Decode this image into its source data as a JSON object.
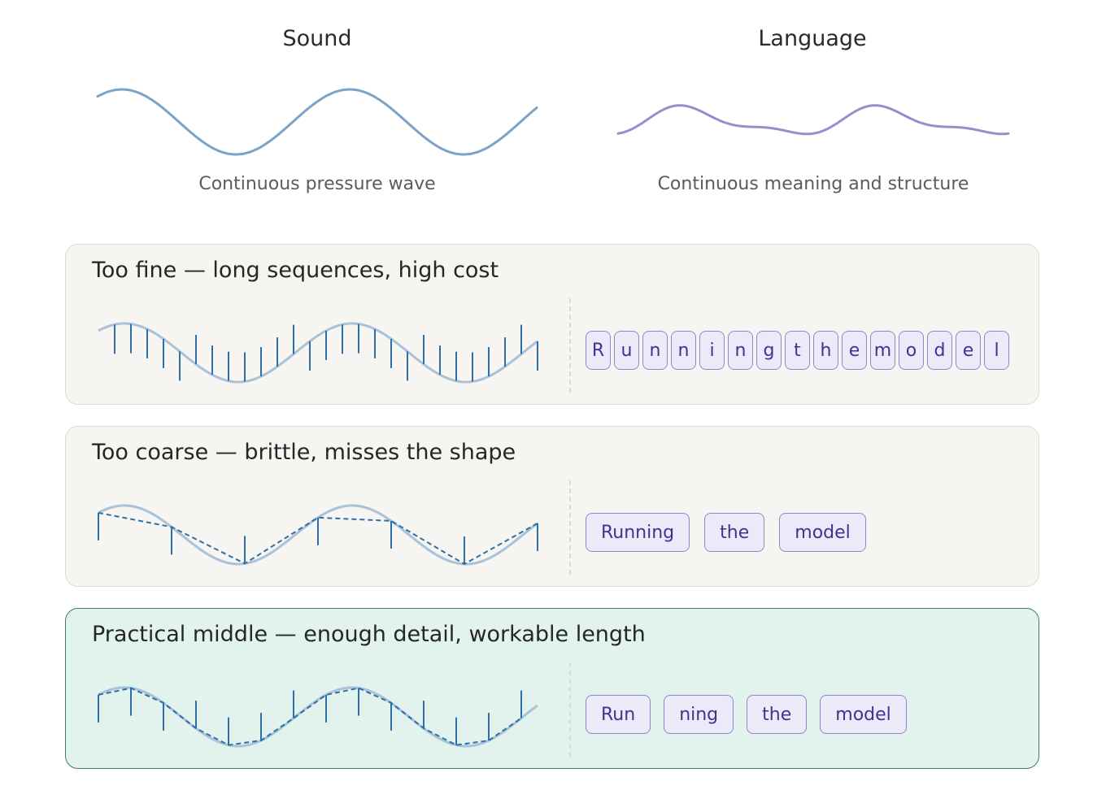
{
  "columns": {
    "sound": {
      "title": "Sound",
      "caption": "Continuous pressure wave"
    },
    "language": {
      "title": "Language",
      "caption": "Continuous meaning and structure"
    }
  },
  "panels": [
    {
      "title": "Too fine — long sequences, high cost",
      "tokens": [
        "R",
        "u",
        "n",
        "n",
        "i",
        "n",
        "g",
        "t",
        "h",
        "e",
        "m",
        "o",
        "d",
        "e",
        "l"
      ]
    },
    {
      "title": "Too coarse — brittle, misses the shape",
      "tokens": [
        "Running",
        "the",
        "model"
      ]
    },
    {
      "title": "Practical middle — enough detail, workable length",
      "tokens": [
        "Run",
        "ning",
        "the",
        "model"
      ]
    }
  ],
  "colors": {
    "sound_wave": "#7ba3c8",
    "language_wave": "#9c8ccf",
    "sample_line": "#2f6fa8",
    "token_border": "#8f86cf",
    "token_fill": "#eceaf9",
    "token_text": "#3d3490",
    "best_panel_fill": "#e2f3ed",
    "best_panel_border": "#3f7d62"
  }
}
